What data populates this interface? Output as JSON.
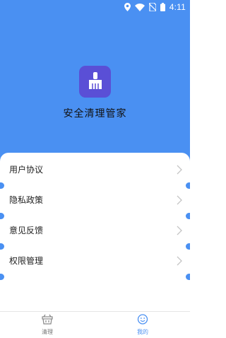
{
  "status_bar": {
    "time": "4:11",
    "icons": [
      "location-icon",
      "wifi-icon",
      "no-sim-icon",
      "battery-icon"
    ]
  },
  "app": {
    "title": "安全清理管家",
    "logo_icon": "broom-icon"
  },
  "menu": {
    "items": [
      {
        "label": "用户协议",
        "icon": "chevron-right-icon"
      },
      {
        "label": "隐私政策",
        "icon": "chevron-right-icon"
      },
      {
        "label": "意见反馈",
        "icon": "chevron-right-icon"
      },
      {
        "label": "权限管理",
        "icon": "chevron-right-icon"
      }
    ]
  },
  "tabbar": {
    "tabs": [
      {
        "label": "清理",
        "icon": "basket-icon",
        "active": false
      },
      {
        "label": "我的",
        "icon": "smiley-icon",
        "active": true
      }
    ]
  },
  "colors": {
    "primary": "#4a90f2",
    "logo_bg": "#5a4fd6",
    "text": "#222222",
    "inactive_tab": "#777777"
  }
}
